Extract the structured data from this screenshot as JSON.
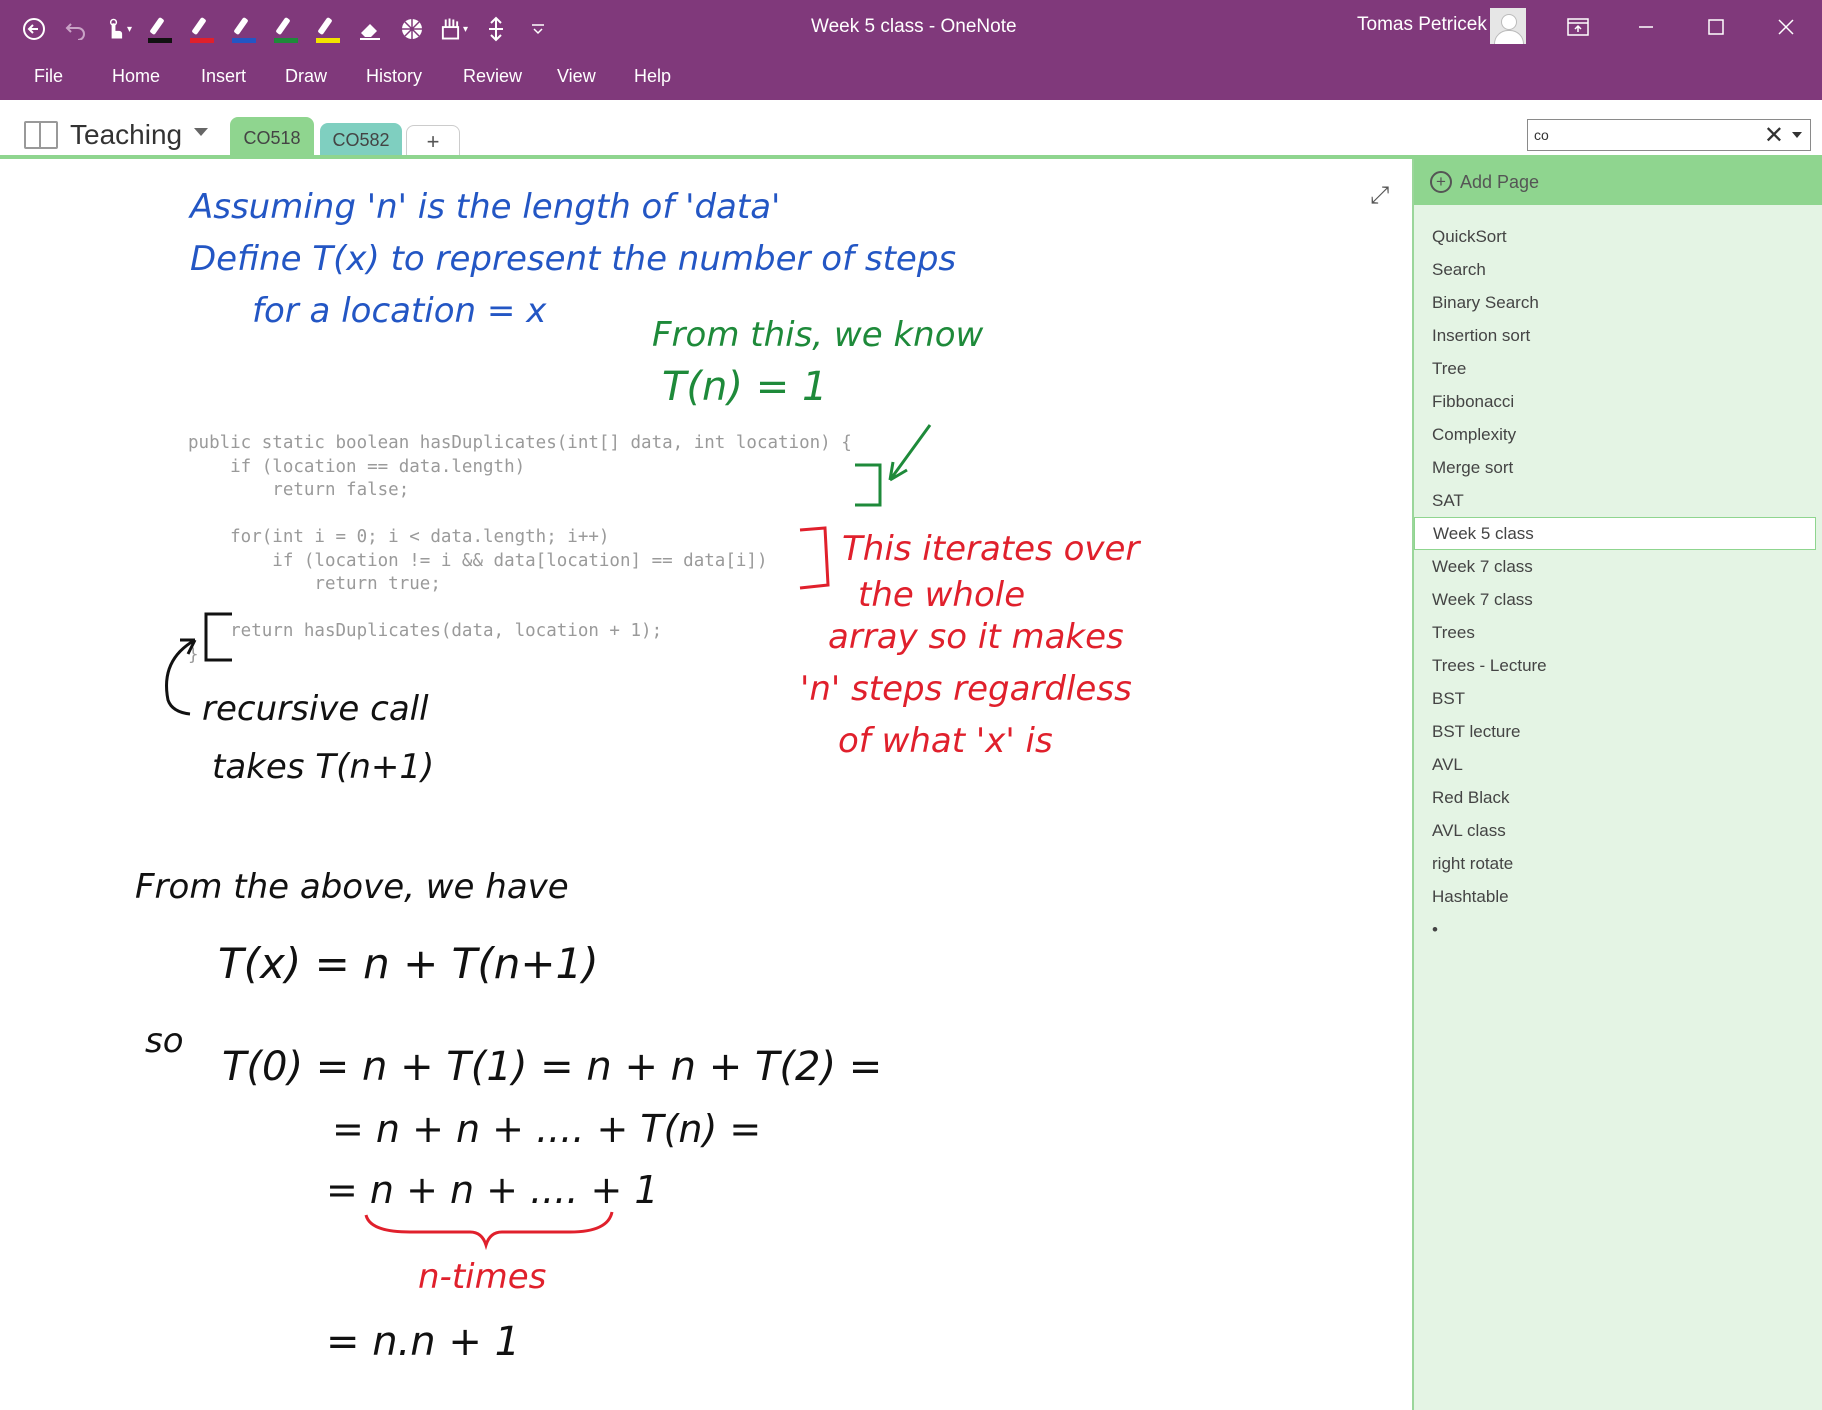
{
  "window": {
    "title": "Week 5 class  -  OneNote",
    "user": "Tomas Petricek",
    "controls": [
      "restore-ribbon",
      "minimize",
      "maximize",
      "close"
    ]
  },
  "ribbon": {
    "tabs": [
      "File",
      "Home",
      "Insert",
      "Draw",
      "History",
      "Review",
      "View",
      "Help"
    ]
  },
  "notebook": {
    "name": "Teaching",
    "sections": [
      {
        "label": "CO518",
        "color": "#8fd58f",
        "active": true
      },
      {
        "label": "CO582",
        "color": "#7fcfc0",
        "active": false
      }
    ],
    "add_section": "+"
  },
  "search": {
    "value": "co"
  },
  "pages": {
    "add_label": "Add Page",
    "items": [
      "QuickSort",
      "Search",
      "Binary Search",
      "Insertion sort",
      "Tree",
      "Fibbonacci",
      "Complexity",
      "Merge sort",
      "SAT",
      "Week 5 class",
      "Week 7 class",
      "Week 7 class",
      "Trees",
      "Trees - Lecture",
      "BST",
      "BST lecture",
      "AVL",
      "Red Black",
      "AVL class",
      "right rotate",
      "Hashtable",
      "•"
    ],
    "selected_index": 9
  },
  "code": {
    "lines": [
      "public static boolean hasDuplicates(int[] data, int location) {",
      "    if (location == data.length)",
      "        return false;",
      "",
      "    for(int i = 0; i < data.length; i++)",
      "        if (location != i && data[location] == data[i])",
      "            return true;",
      "",
      "    return hasDuplicates(data, location + 1);",
      "}"
    ]
  },
  "handwriting": {
    "blue": {
      "line1": "Assuming 'n' is the length of 'data'",
      "line2": "Define T(x) to represent the number of steps",
      "line3": "for a location = x"
    },
    "green": {
      "line1": "From this, we know",
      "line2": "T(n) = 1"
    },
    "red": {
      "line1": "This iterates over",
      "line2": "the whole",
      "line3": "array so it makes",
      "line4": "'n' steps regardless",
      "line5": "of what 'x' is",
      "ntimes": "n-times"
    },
    "black": {
      "rec1": "recursive call",
      "rec2": "takes T(n+1)",
      "above": "From the above, we have",
      "eq1": "T(x) = n + T(n+1)",
      "so": "so",
      "eq2": "T(0) = n + T(1) = n + n + T(2) =",
      "eq3": "= n + n + .... + T(n) =",
      "eq4": "= n + n + .... + 1",
      "eq5": "= n.n + 1"
    }
  },
  "colors": {
    "titlebar": "#80397b",
    "ink_blue": "#2356c4",
    "ink_green": "#1e8a3a",
    "ink_red": "#e0202c",
    "ink_black": "#111111",
    "pagelist_bg": "#e4f4e4",
    "accent_green": "#8fd58f"
  }
}
